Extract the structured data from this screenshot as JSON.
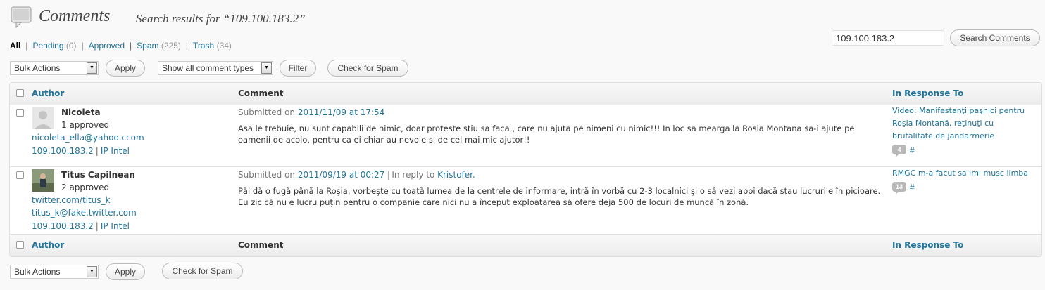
{
  "header": {
    "title": "Comments",
    "subtitle": "Search results for “109.100.183.2”",
    "icon": "comments-icon"
  },
  "filters": {
    "all": "All",
    "pending": "Pending",
    "pending_count": "(0)",
    "approved": "Approved",
    "spam": "Spam",
    "spam_count": "(225)",
    "trash": "Trash",
    "trash_count": "(34)"
  },
  "search": {
    "value": "109.100.183.2",
    "button": "Search Comments"
  },
  "toolbar_top": {
    "bulk_actions": "Bulk Actions",
    "apply": "Apply",
    "comment_type": "Show all comment types",
    "filter": "Filter",
    "check_spam": "Check for Spam"
  },
  "columns": {
    "author": "Author",
    "comment": "Comment",
    "response": "In Response To"
  },
  "rows": [
    {
      "author_name": "Nicoleta",
      "approved": "1 approved",
      "email": "nicoleta_ella@yahoo.ccom",
      "ip": "109.100.183.2",
      "ip_intel": "IP Intel",
      "submitted_prefix": "Submitted on",
      "date": "2011/11/09 at 17:54",
      "text": "Asa le trebuie, nu sunt capabili de nimic, doar proteste stiu sa faca , care nu ajuta pe nimeni cu nimic!!! In loc sa mearga la Rosia Montana sa-i ajute pe oamenii de acolo, pentru ca ei chiar au nevoie si de cel mai mic ajutor!!",
      "response_title": "Video: Manifestanţi paşnici pentru Roşia Montană, reţinuţi cu brutalitate de jandarmerie",
      "response_count": "4",
      "hash": "#"
    },
    {
      "author_name": "Titus Capilnean",
      "approved": "2 approved",
      "website": "twitter.com/titus_k",
      "email": "titus_k@fake.twitter.com",
      "ip": "109.100.183.2",
      "ip_intel": "IP Intel",
      "submitted_prefix": "Submitted on",
      "date": "2011/09/19 at 00:27",
      "reply_prefix": "In reply to",
      "reply_to": "Kristofer.",
      "text": "Păi dă o fugă până la Roşia, vorbeşte cu toată lumea de la centrele de informare, intră în vorbă cu 2-3 localnici şi o să vezi apoi dacă stau lucrurile în picioare. Eu zic că nu e lucru puţin pentru o companie care nici nu a început exploatarea să ofere deja 500 de locuri de muncă în zonă.",
      "response_title": "RMGC m-a facut sa imi musc limba",
      "response_count": "13",
      "hash": "#"
    }
  ],
  "toolbar_bottom": {
    "bulk_actions": "Bulk Actions",
    "apply": "Apply",
    "check_spam": "Check for Spam"
  },
  "colors": {
    "link": "#21759b",
    "background": "#f9f9f9",
    "bubble": "#b8b8b8"
  }
}
